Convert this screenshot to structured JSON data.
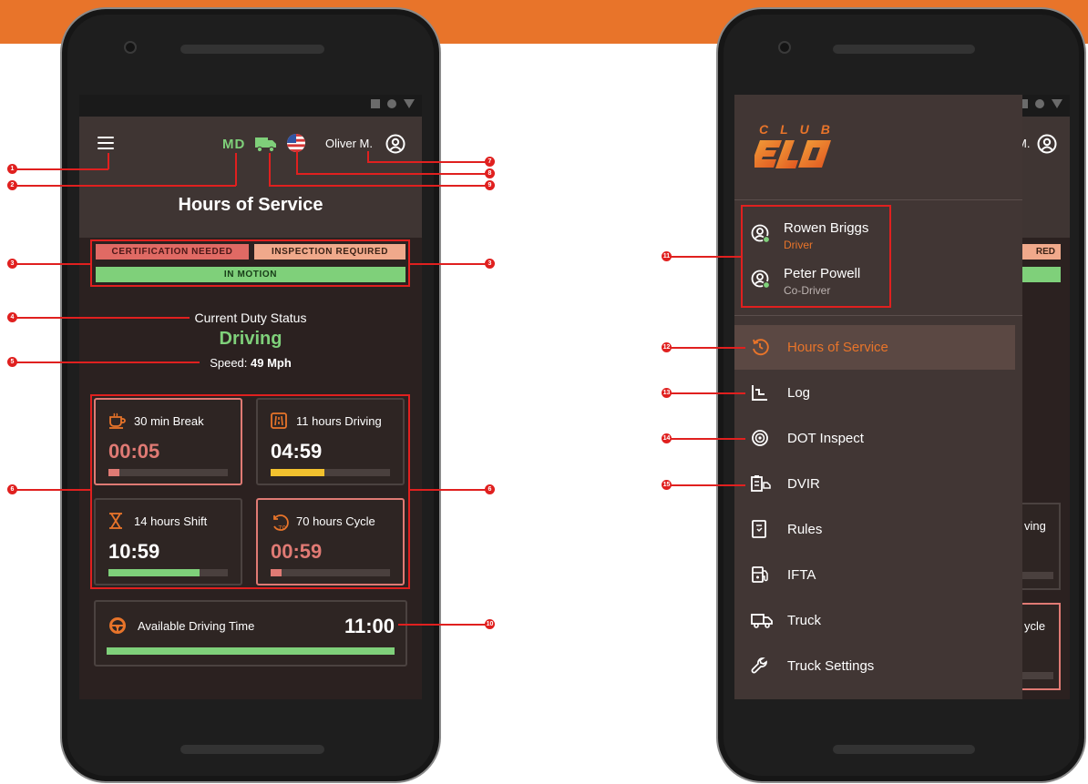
{
  "status_icons": [
    "square-icon",
    "circle-icon",
    "triangle-icon"
  ],
  "left_screen": {
    "state_code": "MD",
    "user_name": "Oliver M.",
    "page_title": "Hours of Service",
    "badges": {
      "certification": "CERTIFICATION NEEDED",
      "inspection": "INSPECTION REQUIRED",
      "motion": "IN MOTION"
    },
    "duty_label": "Current Duty Status",
    "duty_value": "Driving",
    "speed_label": "Speed:",
    "speed_value": "49 Mph",
    "cards": [
      {
        "title": "30 min Break",
        "time": "00:05",
        "progress": 0.09,
        "color": "#e07a74"
      },
      {
        "title": "11 hours Driving",
        "time": "04:59",
        "progress": 0.45,
        "color": "#f2c12e"
      },
      {
        "title": "14 hours Shift",
        "time": "10:59",
        "progress": 0.76,
        "color": "#7fd07a"
      },
      {
        "title": "70 hours Cycle",
        "time": "00:59",
        "progress": 0.09,
        "color": "#e07a74"
      }
    ],
    "available_label": "Available Driving Time",
    "available_value": "11:00",
    "available_progress": 1.0
  },
  "right_screen": {
    "logo_text": "CLUB",
    "logo_mark": "ELD",
    "drivers": [
      {
        "name": "Rowen Briggs",
        "role": "Driver"
      },
      {
        "name": "Peter Powell",
        "role": "Co-Driver"
      }
    ],
    "menu": [
      {
        "label": "Hours of Service",
        "icon": "history-icon",
        "active": true
      },
      {
        "label": "Log",
        "icon": "log-chart-icon"
      },
      {
        "label": "DOT Inspect",
        "icon": "dot-inspect-icon"
      },
      {
        "label": "DVIR",
        "icon": "dvir-icon"
      },
      {
        "label": "Rules",
        "icon": "rules-icon"
      },
      {
        "label": "IFTA",
        "icon": "ifta-icon"
      },
      {
        "label": "Truck",
        "icon": "truck-icon"
      },
      {
        "label": "Truck Settings",
        "icon": "wrench-icon"
      }
    ],
    "behind_user_initial": "M.",
    "behind_badge": "RED",
    "behind_card_1": "ving",
    "behind_card_2": "ycle"
  },
  "annotations": [
    "1",
    "2",
    "3",
    "3",
    "4",
    "5",
    "6",
    "6",
    "7",
    "8",
    "9",
    "10",
    "11",
    "12",
    "13",
    "14",
    "15"
  ],
  "colors": {
    "accent_orange": "#e8742a",
    "status_green": "#7fd07a",
    "status_red": "#e07a74",
    "annotation_red": "#e0201f",
    "bar_yellow": "#f2c12e"
  }
}
